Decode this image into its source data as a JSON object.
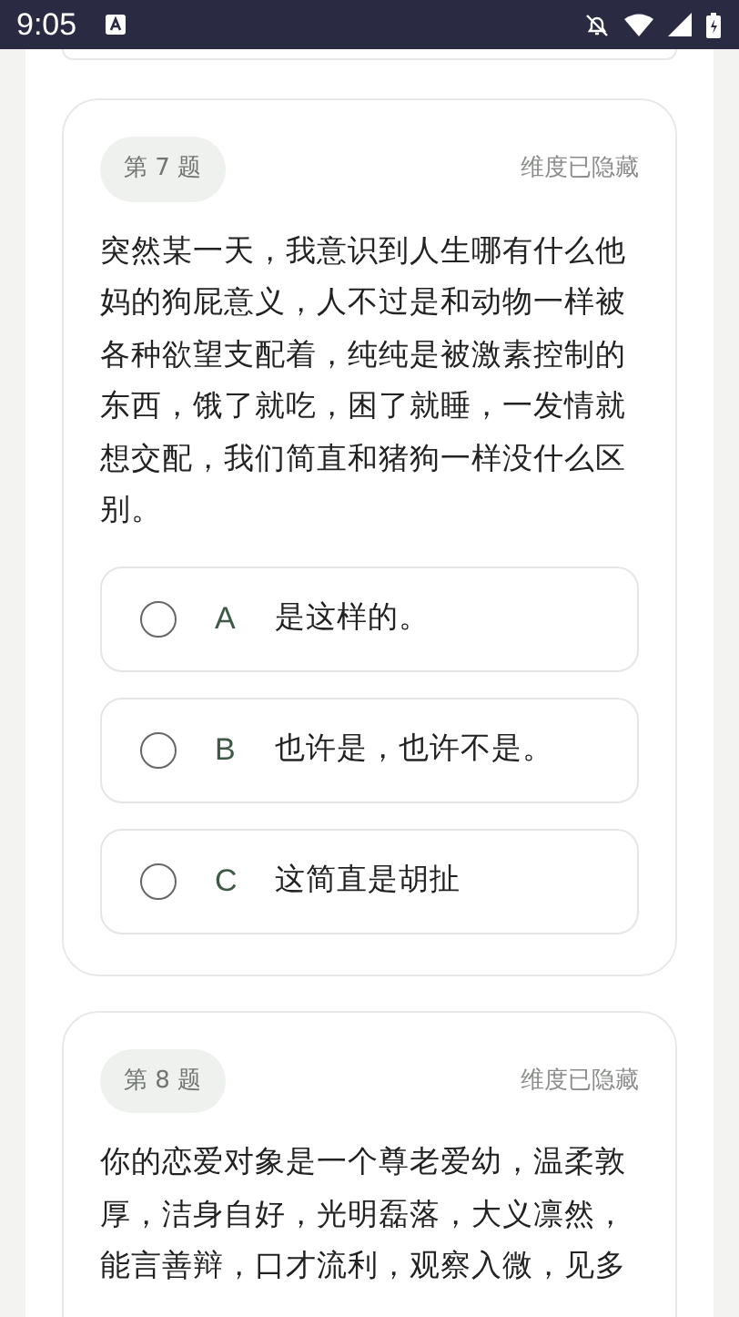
{
  "status_bar": {
    "time": "9:05"
  },
  "questions": [
    {
      "number": "第 7 题",
      "dimension": "维度已隐藏",
      "text": "突然某一天，我意识到人生哪有什么他妈的狗屁意义，人不过是和动物一样被各种欲望支配着，纯纯是被激素控制的东西，饿了就吃，困了就睡，一发情就想交配，我们简直和猪狗一样没什么区别。",
      "options": [
        {
          "letter": "A",
          "text": "是这样的。",
          "selected": false
        },
        {
          "letter": "B",
          "text": "也许是，也许不是。",
          "selected": false
        },
        {
          "letter": "C",
          "text": "这简直是胡扯",
          "selected": false
        }
      ]
    },
    {
      "number": "第 8 题",
      "dimension": "维度已隐藏",
      "text": "你的恋爱对象是一个尊老爱幼，温柔敦厚，洁身自好，光明磊落，大义凛然，能言善辩，口才流利，观察入微，见多"
    }
  ]
}
